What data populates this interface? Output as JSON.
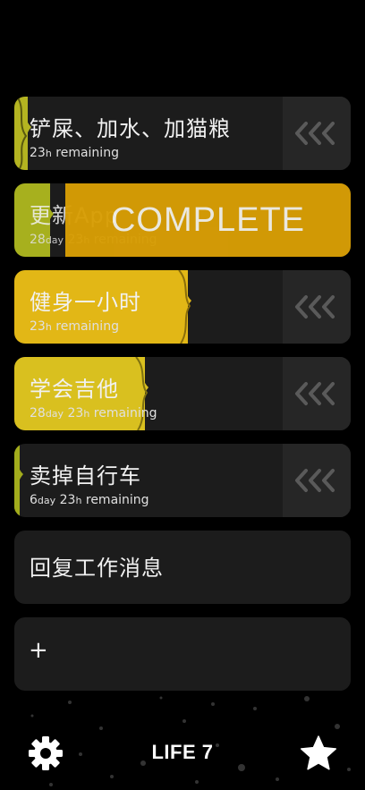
{
  "tasks": [
    {
      "title": "铲屎、加水、加猫粮",
      "remaining_h": "23",
      "h_unit": "h",
      "remaining_label": " remaining",
      "progress": 0.04,
      "fill_color": "#b4b421"
    },
    {
      "title": "更新App",
      "remaining_d": "28",
      "d_unit": "day",
      "remaining_h": "23",
      "h_unit": "h",
      "remaining_label": " remaining",
      "progress": 0.15,
      "fill_color": "#a7b01e",
      "overlay_label": "COMPLETE",
      "overlay_color": "#d89e06"
    },
    {
      "title": "健身一小时",
      "remaining_h": "23",
      "h_unit": "h",
      "remaining_label": " remaining",
      "progress": 0.53,
      "fill_color": "#e2b716"
    },
    {
      "title": "学会吉他",
      "remaining_d": "28",
      "d_unit": "day",
      "remaining_h": "23",
      "h_unit": "h",
      "remaining_label": " remaining",
      "progress": 0.4,
      "fill_color": "#d9c01f"
    },
    {
      "title": "卖掉自行车",
      "remaining_d": "6",
      "d_unit": "day",
      "remaining_h": "23",
      "h_unit": "h",
      "remaining_label": " remaining",
      "progress": 0.02,
      "fill_color": "#a2ac1c"
    },
    {
      "title": "回复工作消息"
    }
  ],
  "add_label": "+",
  "swipe_icon": "triple-chevron-left-icon",
  "footer": {
    "settings_icon": "gear-icon",
    "title": "LIFE 7",
    "favorite_icon": "star-icon"
  },
  "colors": {
    "card_bg": "#1c1c1c",
    "swipe_bg": "#262626",
    "background": "#000000"
  }
}
